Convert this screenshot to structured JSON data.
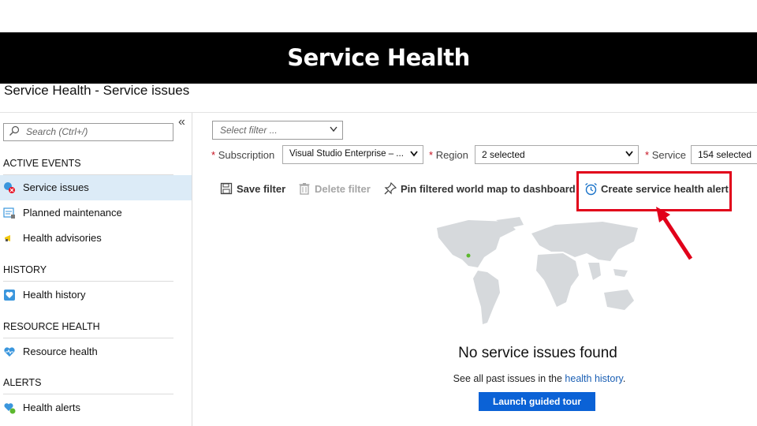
{
  "banner": {
    "title": "Service Health"
  },
  "page": {
    "title": "Service Health - Service issues"
  },
  "sidebar": {
    "search_placeholder": "Search (Ctrl+/)",
    "collapse_glyph": "«",
    "sections": [
      {
        "heading": "ACTIVE EVENTS",
        "items": [
          {
            "label": "Service issues",
            "icon": "service-issues-icon",
            "active": true
          },
          {
            "label": "Planned maintenance",
            "icon": "planned-maintenance-icon"
          },
          {
            "label": "Health advisories",
            "icon": "health-advisories-icon"
          }
        ]
      },
      {
        "heading": "HISTORY",
        "items": [
          {
            "label": "Health history",
            "icon": "health-history-icon"
          }
        ]
      },
      {
        "heading": "RESOURCE HEALTH",
        "items": [
          {
            "label": "Resource health",
            "icon": "heart-icon"
          }
        ]
      },
      {
        "heading": "ALERTS",
        "items": [
          {
            "label": "Health alerts",
            "icon": "health-alerts-icon"
          }
        ]
      }
    ]
  },
  "filters": {
    "select_filter_placeholder": "Select filter ...",
    "required_mark": "*",
    "subscription": {
      "label": "Subscription",
      "value": "Visual Studio Enterprise – ..."
    },
    "region": {
      "label": "Region",
      "value": "2 selected"
    },
    "service": {
      "label": "Service",
      "value": "154 selected"
    }
  },
  "toolbar": {
    "save_filter": "Save filter",
    "delete_filter": "Delete filter",
    "pin_map": "Pin filtered world map to dashboard",
    "create_alert": "Create service health alert"
  },
  "empty_state": {
    "title": "No service issues found",
    "subtitle_prefix": "See all past issues in the ",
    "subtitle_link": "health history",
    "subtitle_suffix": ".",
    "button": "Launch guided tour"
  },
  "colors": {
    "accent": "#0b62d6",
    "highlight": "#e1001a",
    "active_nav": "#dcebf7",
    "map": "#d6d9dc",
    "map_dot": "#5cb82e"
  }
}
